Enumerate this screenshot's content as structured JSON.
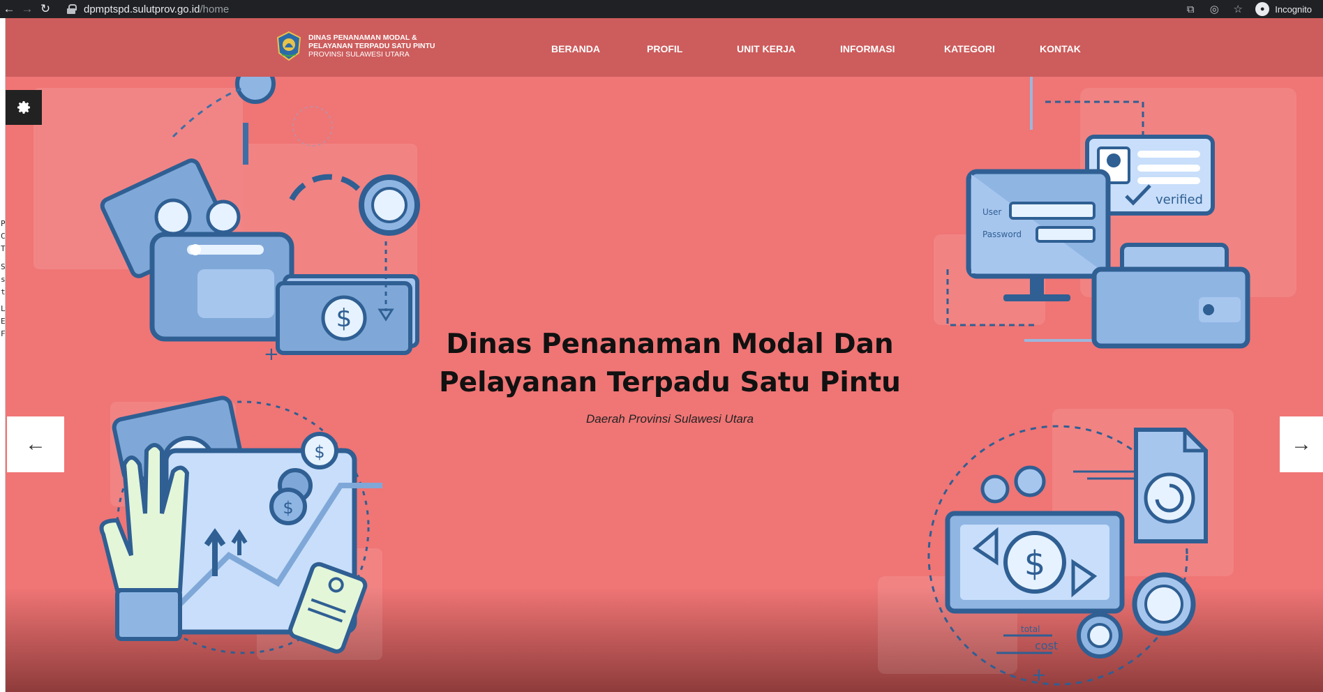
{
  "browser": {
    "url_host": "dpmptspd.sulutprov.go.id",
    "url_path": "/home",
    "incognito_label": "Incognito",
    "back_icon": "←",
    "forward_icon": "→",
    "reload_icon": "↻"
  },
  "header": {
    "brand_line1": "DINAS PENANAMAN MODAL &",
    "brand_line2": "PELAYANAN TERPADU SATU PINTU",
    "brand_line3": "PROVINSI SULAWESI UTARA",
    "menu": [
      "BERANDA",
      "PROFIL",
      "UNIT KERJA",
      "INFORMASI",
      "KATEGORI",
      "KONTAK"
    ]
  },
  "hero": {
    "title_line1": "Dinas Penanaman Modal Dan",
    "title_line2": "Pelayanan Terpadu Satu Pintu",
    "subtitle": "Daerah Provinsi Sulawesi Utara",
    "prev_icon": "←",
    "next_icon": "→"
  },
  "illustration_text": {
    "user": "User",
    "password": "Password",
    "verified": "verified",
    "total": "total",
    "cost": "cost"
  },
  "colors": {
    "page_bg": "#f07575",
    "header_bg": "#cd5c5c",
    "illus_blue": "#7fa8d8",
    "illus_dark": "#2f5f93"
  }
}
